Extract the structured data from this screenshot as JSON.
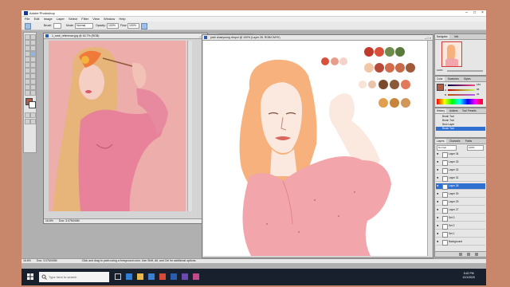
{
  "app": {
    "title": "Adobe Photoshop",
    "window_controls": [
      "–",
      "□",
      "×"
    ]
  },
  "menu": [
    "File",
    "Edit",
    "Image",
    "Layer",
    "Select",
    "Filter",
    "View",
    "Window",
    "Help"
  ],
  "options_bar": {
    "brush_label": "Brush:",
    "mode_label": "Mode:",
    "mode_value": "Normal",
    "opacity_label": "Opacity:",
    "opacity_value": "100%",
    "flow_label": "Flow:",
    "flow_value": "100%",
    "file_browser_tab": "File Browser",
    "brushes_tab": "Brushes"
  },
  "reference_doc": {
    "title": "1_rosé_reference.jpg @ 16.7% (RGB)",
    "status_zoom": "16.6%",
    "status_doc": "Doc: 3.07M/40M"
  },
  "paint_doc": {
    "title": "park chaeyoung drupol @ 100% (Layer 28, RGB/CMYK)",
    "status_hint": "Click and drag to paint using a foreground color. Use Shift, Alt, and Ctrl for additional options."
  },
  "navigator": {
    "tabs": [
      "Navigator",
      "Info"
    ],
    "zoom": "100%"
  },
  "color_panel": {
    "tabs": [
      "Color",
      "Swatches",
      "Styles"
    ],
    "channels": [
      "R",
      "G",
      "B"
    ],
    "values": [
      "183",
      "88",
      "64"
    ]
  },
  "history_panel": {
    "tabs": [
      "History",
      "Actions",
      "Tool Presets"
    ],
    "items": [
      "Brush Tool",
      "Brush Tool",
      "New Layer",
      "Brush Tool"
    ]
  },
  "layers_panel": {
    "tabs": [
      "Layers",
      "Channels",
      "Paths"
    ],
    "mode": "Normal",
    "opacity": "100%",
    "rows": [
      "Layer 34",
      "Layer 33",
      "Layer 32",
      "Layer 31",
      "Layer 28",
      "Layer 30",
      "Layer 29",
      "Layer 27",
      "Set 3",
      "Set 2",
      "Set 1",
      "Background"
    ],
    "selected_index": 4
  },
  "palette_colors": [
    "#c0392b",
    "#d94f3a",
    "#e8a86a",
    "#efd0b4",
    "#b84a3a",
    "#d26a4c",
    "#6f8a4a",
    "#5a7a3c",
    "#c66a4a",
    "#8a5a3a",
    "#f0c09a",
    "#a05a3a",
    "#7a4a2a",
    "#d2955a",
    "#e6b080",
    "#c8843a",
    "#e0a050",
    "#d47a5a",
    "#f2e0c8",
    "#eac4a8"
  ],
  "taskbar": {
    "search_placeholder": "Type here to search",
    "time": "5:42 PM",
    "date": "12/1/2020"
  },
  "colors": {
    "background": "#c8866a",
    "selection": "#2f6fd0",
    "taskbar": "#17202c",
    "foreground_swatch": "#b75840",
    "background_swatch": "#ffffff"
  }
}
